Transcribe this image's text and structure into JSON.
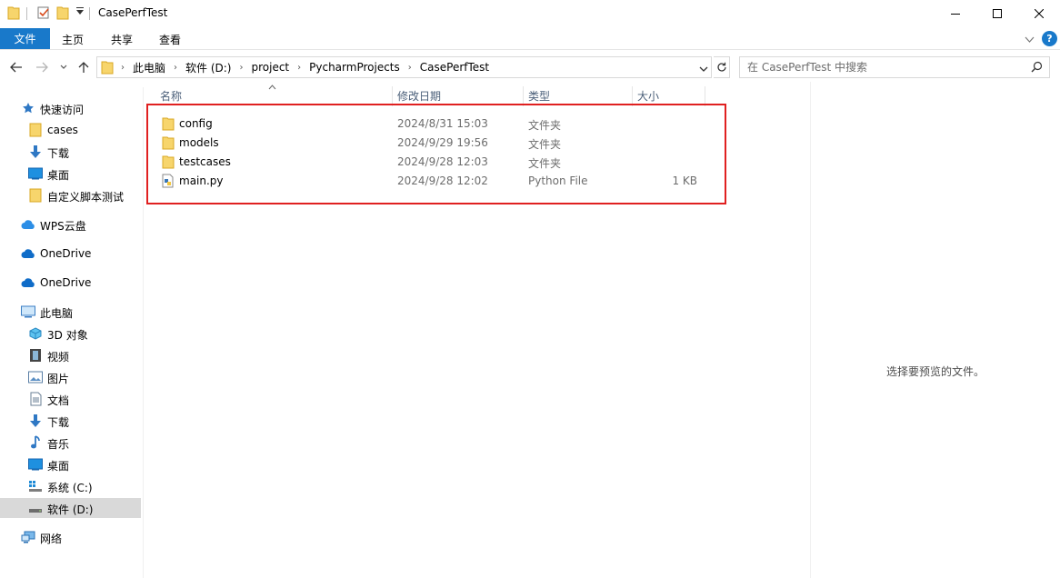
{
  "window": {
    "title": "CasePerfTest"
  },
  "ribbon": {
    "file_tab": "文件",
    "tabs": [
      "主页",
      "共享",
      "查看"
    ],
    "help": "?"
  },
  "address": {
    "crumbs": [
      "此电脑",
      "软件 (D:)",
      "project",
      "PycharmProjects",
      "CasePerfTest"
    ]
  },
  "search": {
    "placeholder": "在 CasePerfTest 中搜索"
  },
  "sidebar": {
    "quick_access": "快速访问",
    "quick_items": [
      "cases",
      "下载",
      "桌面",
      "自定义脚本测试"
    ],
    "wps": "WPS云盘",
    "onedrive1": "OneDrive",
    "onedrive2": "OneDrive",
    "this_pc": "此电脑",
    "pc_items": [
      "3D 对象",
      "视频",
      "图片",
      "文档",
      "下载",
      "音乐",
      "桌面",
      "系统 (C:)",
      "软件 (D:)"
    ],
    "network": "网络"
  },
  "columns": {
    "name": "名称",
    "date": "修改日期",
    "type": "类型",
    "size": "大小"
  },
  "files": [
    {
      "name": "config",
      "date": "2024/8/31 15:03",
      "type": "文件夹",
      "size": "",
      "icon": "folder-icon"
    },
    {
      "name": "models",
      "date": "2024/9/29 19:56",
      "type": "文件夹",
      "size": "",
      "icon": "folder-icon"
    },
    {
      "name": "testcases",
      "date": "2024/9/28 12:03",
      "type": "文件夹",
      "size": "",
      "icon": "folder-icon"
    },
    {
      "name": "main.py",
      "date": "2024/9/28 12:02",
      "type": "Python File",
      "size": "1 KB",
      "icon": "python-file-icon"
    }
  ],
  "preview": {
    "message": "选择要预览的文件。"
  },
  "colors": {
    "accent": "#1979ca",
    "highlight_border": "#e02020",
    "selected_bg": "#d9d9d9",
    "folder": "#f7d56c"
  }
}
